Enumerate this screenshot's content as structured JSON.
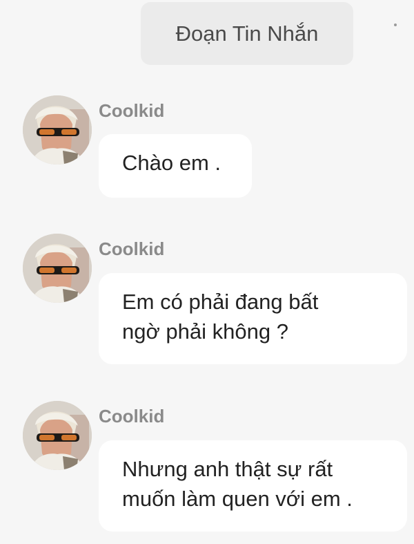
{
  "header": {
    "title": "Đoạn Tin Nhắn"
  },
  "messages": [
    {
      "sender": "Coolkid",
      "text": "Chào em ."
    },
    {
      "sender": "Coolkid",
      "text": "Em có phải đang bất\nngờ phải không ?"
    },
    {
      "sender": "Coolkid",
      "text": "Nhưng anh thật sự rất\nmuốn làm quen với em ."
    }
  ],
  "colors": {
    "background": "#f6f6f6",
    "header_background": "#ebebeb",
    "bubble_background": "#ffffff",
    "sender_name": "#8a8a8a",
    "text": "#222222"
  }
}
